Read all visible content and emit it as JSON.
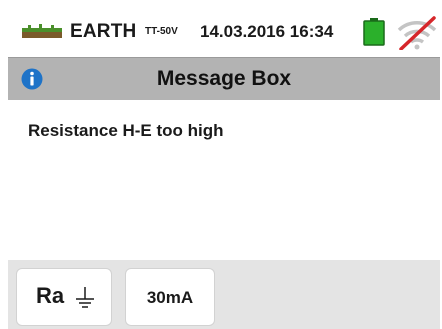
{
  "status_bar": {
    "mode": "EARTH",
    "mode_sub": "TT-50V",
    "datetime": "14.03.2016 16:34",
    "icons": {
      "earth": "earth-measurement-icon",
      "battery": "battery-icon",
      "wireless": "wifi-off-icon"
    },
    "battery_color": "#2bb02b",
    "wireless_slash_color": "#d6262a"
  },
  "title_bar": {
    "title": "Message Box",
    "icon": "info-icon",
    "background": "#b3b3b3"
  },
  "message": {
    "text": "Resistance H-E too high"
  },
  "softkeys": [
    {
      "label": "Ra",
      "icon": "ground-icon"
    },
    {
      "label": "30mA"
    }
  ]
}
